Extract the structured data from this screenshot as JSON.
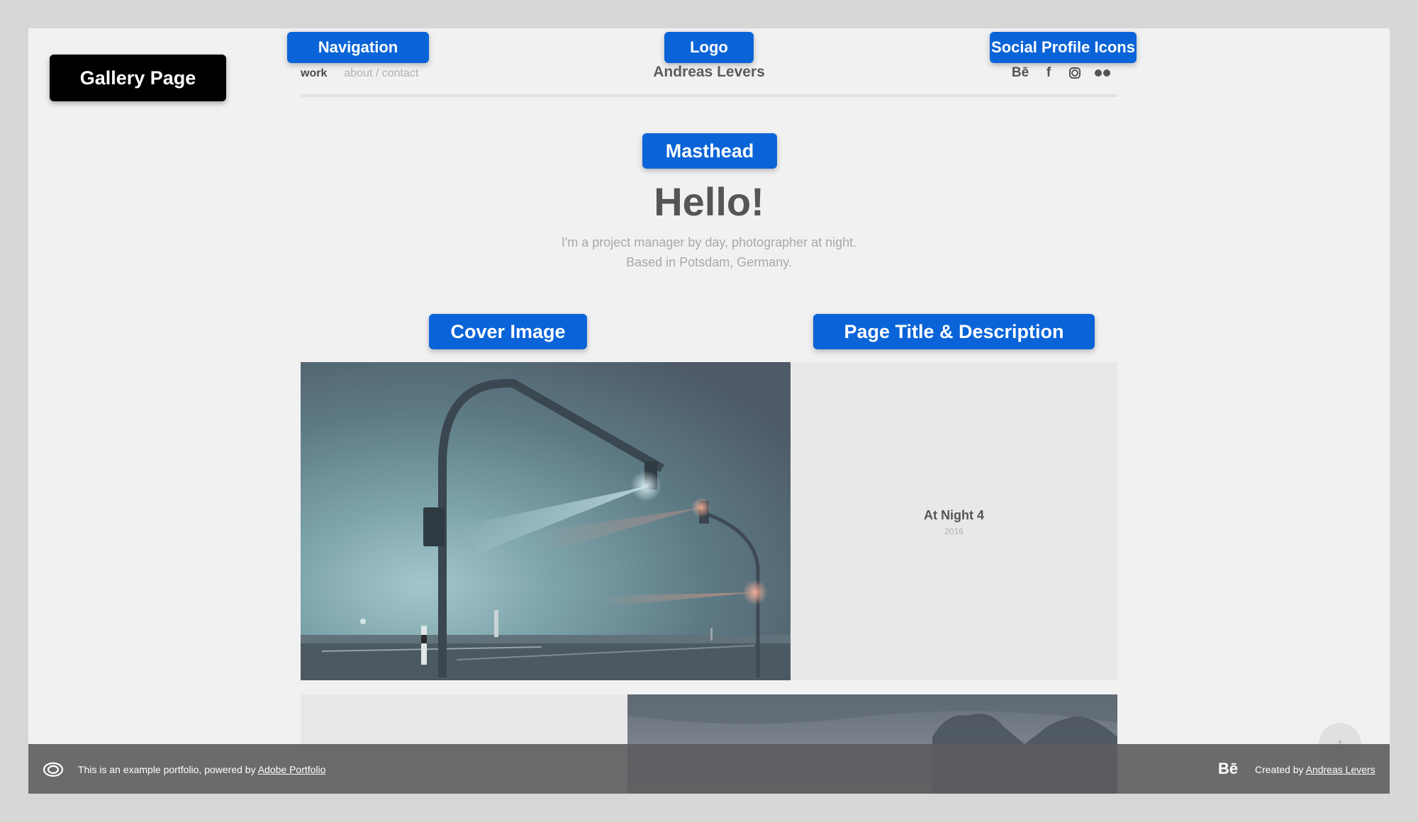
{
  "annotations": {
    "gallery_page": "Gallery Page",
    "navigation": "Navigation",
    "logo": "Logo",
    "social": "Social Profile Icons",
    "masthead": "Masthead",
    "cover_image": "Cover Image",
    "page_title": "Page Title & Description"
  },
  "nav": {
    "work": "work",
    "about_contact": "about / contact"
  },
  "logo": "Andreas Levers",
  "social": {
    "behance": "Bē",
    "facebook": "f",
    "icons": [
      "behance-icon",
      "facebook-icon",
      "instagram-icon",
      "flickr-icon"
    ]
  },
  "masthead": {
    "title": "Hello!",
    "line1": "I'm a project manager by day, photographer at night.",
    "line2": "Based in Potsdam, Germany."
  },
  "project": {
    "title": "At Night 4",
    "year": "2016"
  },
  "footer": {
    "text_prefix": "This is an example portfolio, powered by ",
    "text_link": "Adobe Portfolio",
    "behance": "Bē",
    "credit_prefix": "Created by ",
    "credit_link": "Andreas Levers"
  },
  "scroll_top": "↑",
  "colors": {
    "accent_label": "#0a64d8",
    "footer_bg": "#5c5c5e",
    "page_bg": "#f1f1f2"
  }
}
